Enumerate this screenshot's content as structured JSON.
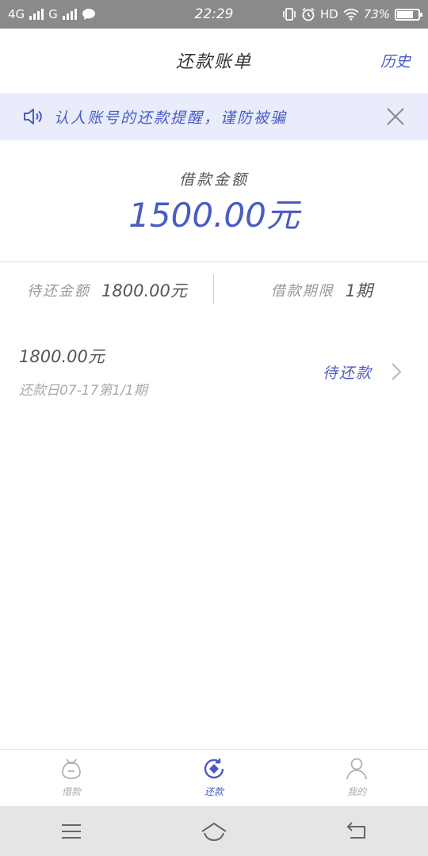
{
  "status_bar": {
    "network1": "4G",
    "network2": "G",
    "time": "22:29",
    "hd": "HD",
    "battery": "73%",
    "battery_level": 0.73
  },
  "header": {
    "title": "还款账单",
    "history": "历史"
  },
  "notice": {
    "text": "认人账号的还款提醒，谨防被骗"
  },
  "loan": {
    "amount_label": "借款金额",
    "amount_value": "1500.00元"
  },
  "summary": {
    "due_label": "待还金额",
    "due_value": "1800.00元",
    "term_label": "借款期限",
    "term_value": "1期"
  },
  "bill": {
    "amount": "1800.00元",
    "date": "还款日07-17第1/1期",
    "status": "待还款"
  },
  "tabs": [
    {
      "label": "借款",
      "icon": "bag-icon",
      "active": false
    },
    {
      "label": "还款",
      "icon": "repay-icon",
      "active": true
    },
    {
      "label": "我的",
      "icon": "person-icon",
      "active": false
    }
  ],
  "colors": {
    "accent": "#4a5bc4",
    "notice_bg": "#e8ecfb",
    "status_bar": "#8a8a8a"
  }
}
